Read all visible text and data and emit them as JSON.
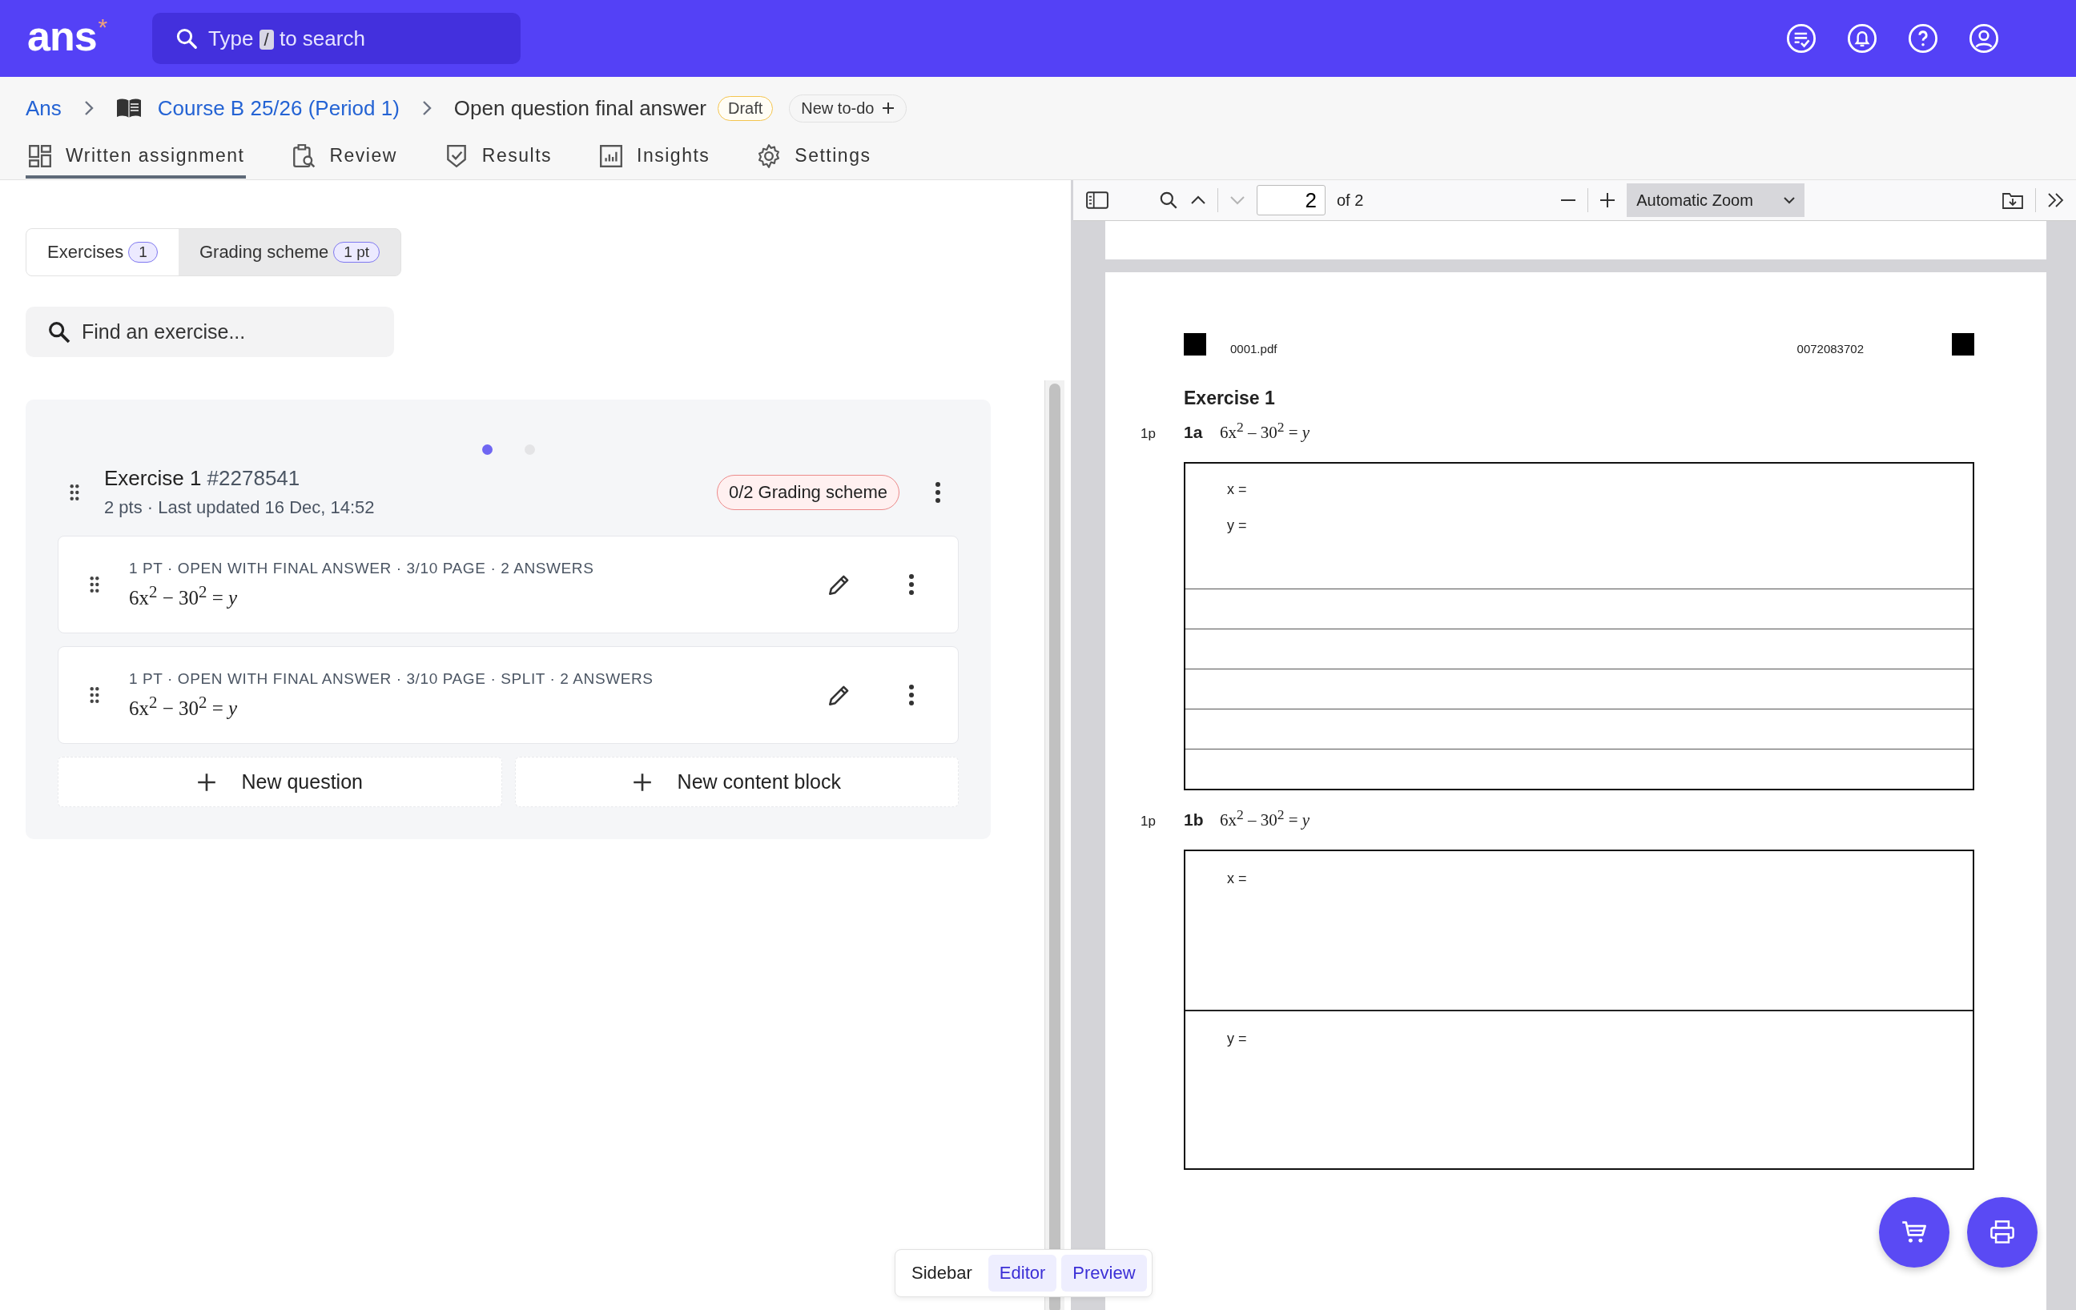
{
  "header": {
    "logo": "ans",
    "logo_mark": "*",
    "search": {
      "before": "Type",
      "key": "/",
      "after": "to search"
    }
  },
  "breadcrumb": {
    "items": [
      {
        "label": "Ans"
      },
      {
        "label": "Course B 25/26 (Period 1)"
      }
    ],
    "title": "Open question final answer",
    "badge": "Draft",
    "todo_button": "New to-do"
  },
  "tabs": [
    {
      "label": "Written assignment",
      "selected": true
    },
    {
      "label": "Review",
      "selected": false
    },
    {
      "label": "Results",
      "selected": false
    },
    {
      "label": "Insights",
      "selected": false
    },
    {
      "label": "Settings",
      "selected": false
    }
  ],
  "segments": [
    {
      "label": "Exercises",
      "count": "1",
      "selected": true
    },
    {
      "label": "Grading scheme",
      "count": "1 pt",
      "selected": false
    }
  ],
  "exercise_search": {
    "placeholder": "Find an exercise..."
  },
  "carousel": [
    {
      "selected": true
    },
    {
      "selected": false
    }
  ],
  "exercise": {
    "title": "Exercise 1",
    "id": "#2278541",
    "meta": "2 pts · Last updated 16 Dec, 14:52",
    "grading_badge": "0/2 Grading scheme",
    "questions": [
      {
        "meta": "1 PT · OPEN WITH FINAL ANSWER · 3/10 PAGE · 2 ANSWERS",
        "formula": "6x$^{2}$ − 30$^{2}$ = *y*"
      },
      {
        "meta": "1 PT · OPEN WITH FINAL ANSWER · 3/10 PAGE · SPLIT · 2 ANSWERS",
        "formula": "6x$^{2}$ − 30$^{2}$ = *y*"
      }
    ],
    "buttons": [
      "New question",
      "New content block"
    ]
  },
  "pdf": {
    "toolbar": {
      "page": "2",
      "page_count": "of 2",
      "zoom": "Automatic Zoom",
      "next_disabled": true
    },
    "document": {
      "filename": "0001.pdf",
      "code": "0072083702",
      "heading": "Exercise 1",
      "parts": [
        {
          "points": "1p",
          "label": "1a",
          "formula": "6x$^{2}$ – 30$^{2}$ = *y*",
          "kind": "lined",
          "fields": [
            "x =",
            "y ="
          ]
        },
        {
          "points": "1p",
          "label": "1b",
          "formula": "6x$^{2}$ – 30$^{2}$ = *y*",
          "kind": "split",
          "fields": [
            "x =",
            "y ="
          ]
        }
      ]
    }
  },
  "view_toggle": [
    {
      "label": "Sidebar",
      "selected": false
    },
    {
      "label": "Editor",
      "selected": true
    },
    {
      "label": "Preview",
      "selected": true
    }
  ]
}
